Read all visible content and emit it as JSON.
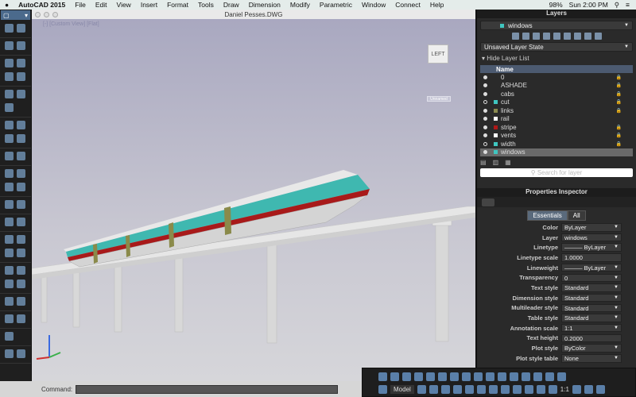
{
  "menubar": {
    "app": "AutoCAD 2015",
    "items": [
      "File",
      "Edit",
      "View",
      "Insert",
      "Format",
      "Tools",
      "Draw",
      "Dimension",
      "Modify",
      "Parametric",
      "Window",
      "Connect",
      "Help"
    ],
    "battery": "98%",
    "clock": "Sun 2:00 PM"
  },
  "document": {
    "title": "Daniel Pesses.DWG",
    "viewport_label": "[-] [Custom View] [Flat]",
    "viewcube_face": "LEFT",
    "view_name": "Unnamed"
  },
  "layers": {
    "title": "Layers",
    "current": "windows",
    "layer_state": "Unsaved Layer State",
    "hide_list": "Hide Layer List",
    "column_name": "Name",
    "search_placeholder": "Search for layer",
    "rows": [
      {
        "name": "0",
        "on": true,
        "color": "",
        "locked": true
      },
      {
        "name": "ASHADE",
        "on": true,
        "color": "",
        "locked": true
      },
      {
        "name": "cabs",
        "on": true,
        "color": "",
        "locked": true
      },
      {
        "name": "cut",
        "on": false,
        "color": "#3fc6c0",
        "locked": true
      },
      {
        "name": "links",
        "on": true,
        "color": "#8a8a50",
        "locked": true
      },
      {
        "name": "rail",
        "on": true,
        "color": "#ffffff",
        "locked": false
      },
      {
        "name": "stripe",
        "on": true,
        "color": "#b01818",
        "locked": true
      },
      {
        "name": "vents",
        "on": true,
        "color": "#ffffff",
        "locked": true
      },
      {
        "name": "width",
        "on": false,
        "color": "#3fc6c0",
        "locked": true
      },
      {
        "name": "windows",
        "on": true,
        "color": "#3fc6c0",
        "locked": false,
        "selected": true
      }
    ]
  },
  "properties": {
    "title": "Properties Inspector",
    "tab_essentials": "Essentials",
    "tab_all": "All",
    "rows": [
      {
        "label": "Color",
        "value": "ByLayer"
      },
      {
        "label": "Layer",
        "value": "windows"
      },
      {
        "label": "Linetype",
        "value": "——— ByLayer"
      },
      {
        "label": "Linetype scale",
        "value": "1.0000"
      },
      {
        "label": "Lineweight",
        "value": "——— ByLayer"
      },
      {
        "label": "Transparency",
        "value": "0"
      },
      {
        "label": "Text style",
        "value": "Standard"
      },
      {
        "label": "Dimension style",
        "value": "Standard"
      },
      {
        "label": "Multileader style",
        "value": "Standard"
      },
      {
        "label": "Table style",
        "value": "Standard"
      },
      {
        "label": "Annotation scale",
        "value": "1:1"
      },
      {
        "label": "Text height",
        "value": "0.2000"
      },
      {
        "label": "Plot style",
        "value": "ByColor"
      },
      {
        "label": "Plot style table",
        "value": "None"
      }
    ]
  },
  "command": {
    "label": "Command:"
  },
  "status": {
    "model": "Model",
    "scale": "1:1"
  }
}
